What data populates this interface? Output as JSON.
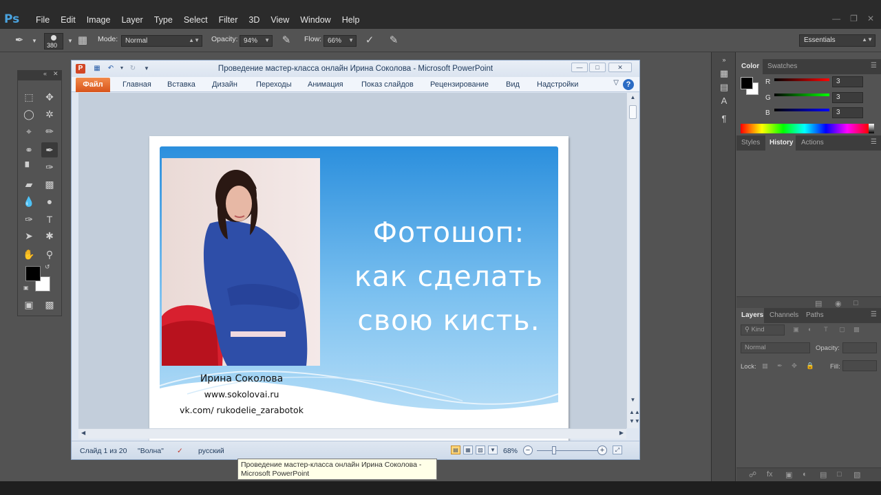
{
  "photoshop": {
    "logo": "Ps",
    "menu": [
      "File",
      "Edit",
      "Image",
      "Layer",
      "Type",
      "Select",
      "Filter",
      "3D",
      "View",
      "Window",
      "Help"
    ],
    "options": {
      "brush_size": "380",
      "mode_label": "Mode:",
      "mode_value": "Normal",
      "opacity_label": "Opacity:",
      "opacity_value": "94%",
      "flow_label": "Flow:",
      "flow_value": "66%"
    },
    "workspace": "Essentials",
    "panels": {
      "color_tabs": [
        "Color",
        "Swatches"
      ],
      "rgb": [
        {
          "label": "R",
          "value": "3"
        },
        {
          "label": "G",
          "value": "3"
        },
        {
          "label": "B",
          "value": "3"
        }
      ],
      "history_tabs": [
        "Styles",
        "History",
        "Actions"
      ],
      "layers_tabs": [
        "Layers",
        "Channels",
        "Paths"
      ],
      "layers_kind": "Kind",
      "layers_mode": "Normal",
      "layers_opacity_label": "Opacity:",
      "layers_lock_label": "Lock:",
      "layers_fill_label": "Fill:"
    },
    "colors": {
      "foreground": "#000000",
      "background": "#ffffff"
    }
  },
  "powerpoint": {
    "title": "Проведение мастер-класса онлайн Ирина Соколова  -  Microsoft PowerPoint",
    "file_tab": "Файл",
    "tabs": [
      "Главная",
      "Вставка",
      "Дизайн",
      "Переходы",
      "Анимация",
      "Показ слайдов",
      "Рецензирование",
      "Вид",
      "Надстройки"
    ],
    "status": {
      "slide": "Слайд 1 из 20",
      "theme": "\"Волна\"",
      "language": "русский",
      "zoom": "68%"
    },
    "slide": {
      "title_lines": [
        "Фотошоп:",
        "как сделать",
        "свою кисть."
      ],
      "author": "Ирина Соколова",
      "site": "www.sokolovai.ru",
      "vk": "vk.com/ rukodelie_zarabotok"
    },
    "accent": "#d24726"
  },
  "tooltip": {
    "line1": "Проведение мастер-класса онлайн Ирина Соколова -",
    "line2": "Microsoft PowerPoint"
  }
}
